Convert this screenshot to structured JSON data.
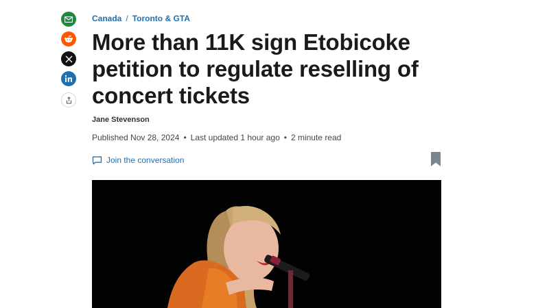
{
  "share": {
    "items": [
      {
        "name": "email",
        "color": "#1f8a3d"
      },
      {
        "name": "reddit",
        "color": "#ff5700"
      },
      {
        "name": "x",
        "color": "#111111"
      },
      {
        "name": "linkedin",
        "color": "#1e6fb0"
      }
    ]
  },
  "breadcrumb": {
    "section": "Canada",
    "separator": "/",
    "subsection": "Toronto & GTA"
  },
  "article": {
    "headline": "More than 11K sign Etobicoke petition to regulate reselling of concert tickets",
    "author": "Jane Stevenson",
    "published": "Published Nov 28, 2024",
    "updated": "Last updated 1 hour ago",
    "read_time": "2 minute read",
    "meta_separator": "•",
    "join_label": "Join the conversation"
  },
  "colors": {
    "link": "#1f6fb3",
    "bookmark": "#7a8590",
    "image_bg": "#020202"
  }
}
